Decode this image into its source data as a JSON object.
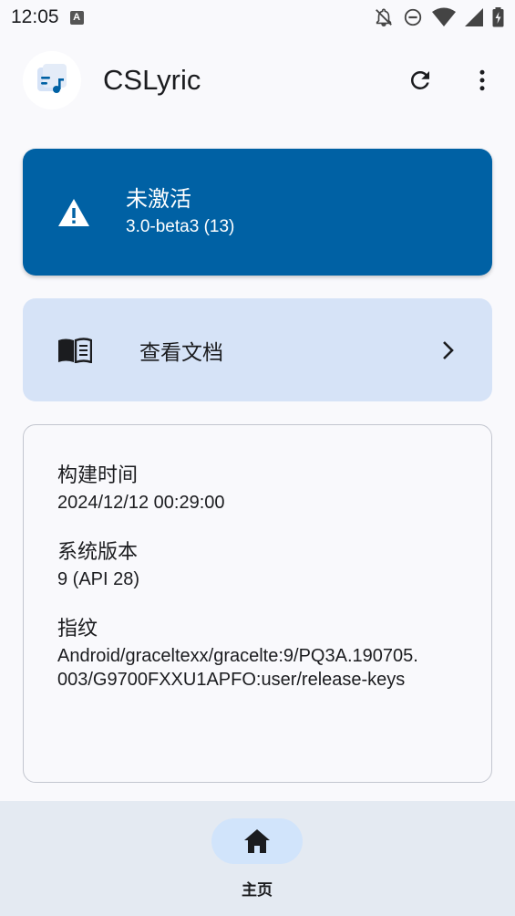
{
  "statusbar": {
    "time": "12:05",
    "notification_badge": "A",
    "icons": [
      "bell-off-icon",
      "do-not-disturb-icon",
      "wifi-icon",
      "cell-signal-icon",
      "battery-icon"
    ]
  },
  "appbar": {
    "title": "CSLyric",
    "icons": [
      "app-logo-icon",
      "refresh-icon",
      "more-vert-icon"
    ]
  },
  "status_card": {
    "title": "未激活",
    "subtitle": "3.0-beta3 (13)",
    "icon": "warning-icon",
    "color": "#0061a4"
  },
  "docs_card": {
    "label": "查看文档",
    "icon": "book-icon",
    "trailing_icon": "chevron-right-icon",
    "color": "#d6e3f7"
  },
  "info_card": {
    "items": [
      {
        "label": "构建时间",
        "value": "2024/12/12 00:29:00"
      },
      {
        "label": "系统版本",
        "value": "9 (API 28)"
      },
      {
        "label": "指纹",
        "value": "Android/graceltexx/gracelte:9/PQ3A.190705.003/G9700FXXU1APFO:user/release-keys"
      }
    ]
  },
  "bottom_nav": {
    "items": [
      {
        "label": "主页",
        "icon": "home-icon",
        "selected": true
      }
    ],
    "color": "#e4eaf2"
  }
}
